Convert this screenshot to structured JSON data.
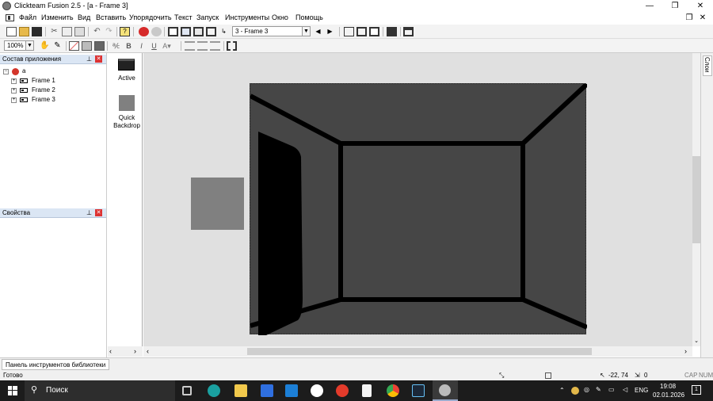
{
  "window": {
    "title": "Clickteam Fusion 2.5 - [a - Frame 3]",
    "minimize_glyph": "—",
    "restore_glyph": "❐",
    "close_glyph": "✕"
  },
  "menu": {
    "items": [
      "Файл",
      "Изменить",
      "Вид",
      "Вставить",
      "Упорядочить",
      "Текст",
      "Запуск",
      "Инструменты",
      "Окно",
      "Помощь"
    ],
    "doc_restore_glyph": "❐",
    "doc_close_glyph": "✕"
  },
  "toolbar": {
    "frame_select": "3 - Frame 3",
    "zoom": "100%",
    "prev_glyph": "◀",
    "next_glyph": "▶",
    "bold": "B",
    "italic": "I",
    "underline": "U"
  },
  "workspace": {
    "header": "Состав приложения",
    "root": "a",
    "frames": [
      "Frame 1",
      "Frame 2",
      "Frame 3"
    ]
  },
  "properties": {
    "header": "Свойства"
  },
  "objects": [
    {
      "label": "Active"
    },
    {
      "label": "Quick Backdrop"
    }
  ],
  "side_tab": "Слои",
  "library_tab": "Панель инструментов библиотеки",
  "status": {
    "text": "Готово",
    "coords": "-22, 74",
    "count": "0",
    "caps": "CAP",
    "num": "NUM"
  },
  "taskbar": {
    "search": "Поиск",
    "lang": "ENG",
    "time": "19:08",
    "date": "02.01.2026",
    "notif": "1"
  },
  "colors": {
    "frame_bg": "#464646",
    "room_lines": "#000000",
    "quick_backdrop": "#808080",
    "editor_bg": "#e0e0e0",
    "taskbar": "#1c1c1c"
  }
}
